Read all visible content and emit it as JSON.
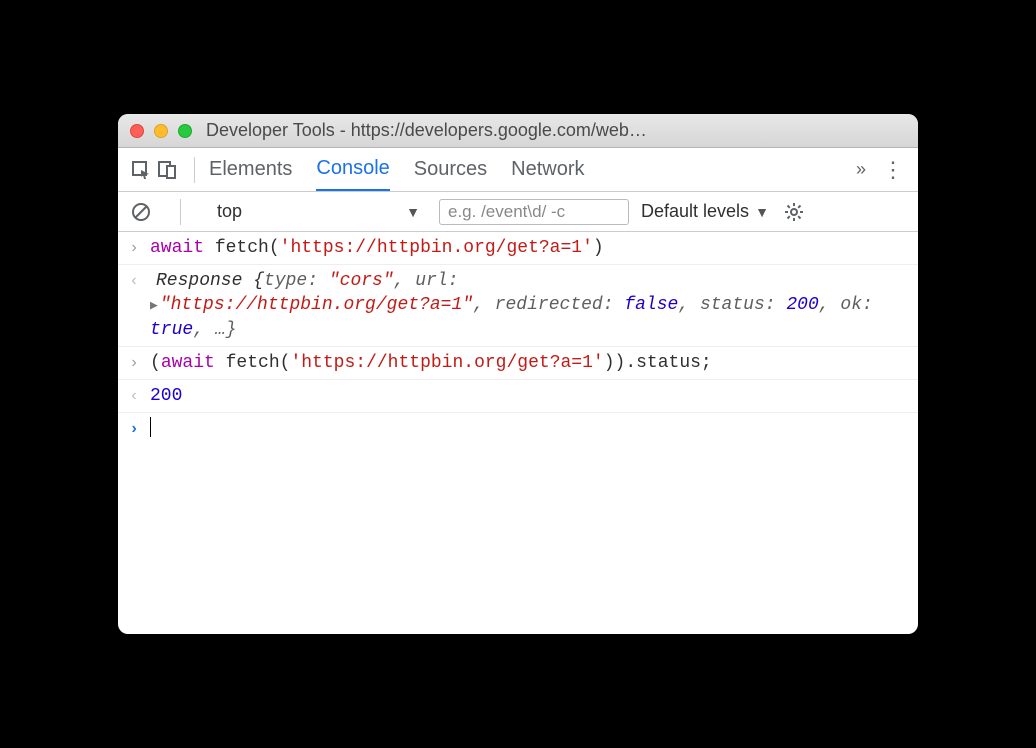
{
  "window": {
    "title": "Developer Tools - https://developers.google.com/web…"
  },
  "tabs": {
    "elements": "Elements",
    "console": "Console",
    "sources": "Sources",
    "network": "Network",
    "overflow": "»"
  },
  "filterbar": {
    "context": "top",
    "filter_placeholder": "e.g. /event\\d/ -c",
    "levels": "Default levels"
  },
  "console": {
    "row1_await": "await",
    "row1_fn": " fetch(",
    "row1_str": "'https://httpbin.org/get?a=1'",
    "row1_close": ")",
    "row2_resp": "Response ",
    "row2_open": "{",
    "row2_k1": "type: ",
    "row2_v1": "\"cors\"",
    "row2_c1": ", ",
    "row2_k2": "url: ",
    "row2_v2": "\"https://httpbin.org/get?a=1\"",
    "row2_c2": ", ",
    "row2_k3": "redirected: ",
    "row2_v3": "false",
    "row2_c3": ", ",
    "row2_k4": "status: ",
    "row2_v4": "200",
    "row2_c4": ", ",
    "row2_k5": "ok: ",
    "row2_v5": "true",
    "row2_c5": ", …}",
    "row3_open": "(",
    "row3_await": "await",
    "row3_fn": " fetch(",
    "row3_str": "'https://httpbin.org/get?a=1'",
    "row3_close": ")).status;",
    "row4_value": "200"
  }
}
